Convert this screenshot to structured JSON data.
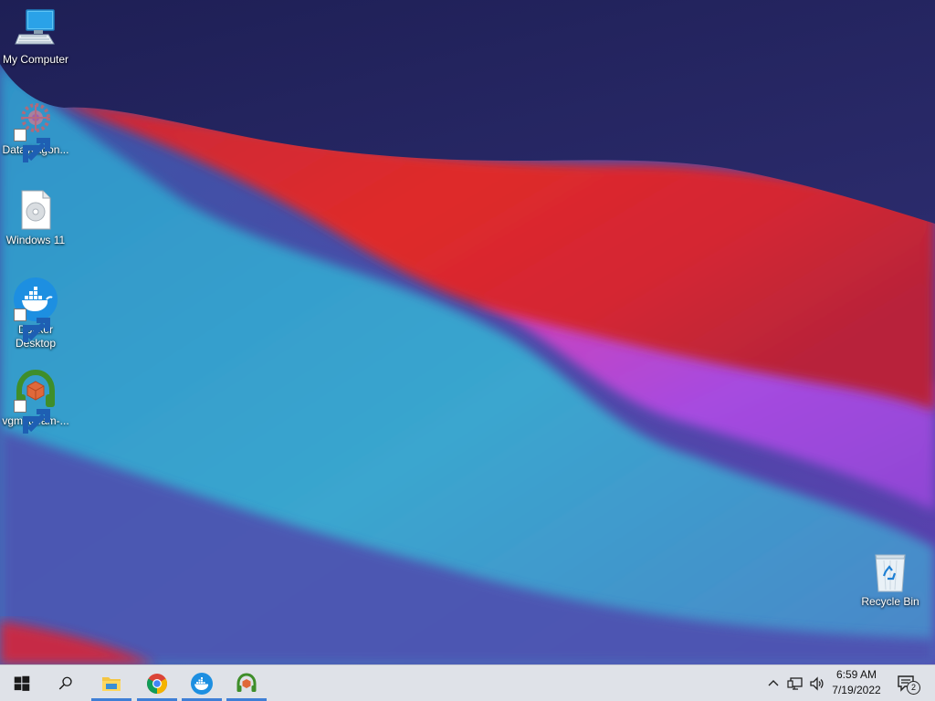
{
  "desktop": {
    "icons": [
      {
        "label": "My Computer",
        "icon": "computer-icon",
        "shortcut": false
      },
      {
        "label": "DataWagon...",
        "icon": "datawagon-icon",
        "shortcut": true
      },
      {
        "label": "Windows 11",
        "icon": "disc-image-file-icon",
        "shortcut": false
      },
      {
        "label": "Docker\nDesktop",
        "icon": "docker-icon",
        "shortcut": true
      },
      {
        "label": "vgmstream-...",
        "icon": "vgmstream-icon",
        "shortcut": true
      }
    ],
    "recycle_bin": {
      "label": "Recycle Bin",
      "icon": "recycle-bin-icon"
    }
  },
  "taskbar": {
    "pinned": [
      {
        "name": "start",
        "icon": "windows-start-icon",
        "active": false
      },
      {
        "name": "search",
        "icon": "search-icon",
        "active": false
      },
      {
        "name": "file-explorer",
        "icon": "file-explorer-icon",
        "active": true
      },
      {
        "name": "chrome",
        "icon": "chrome-icon",
        "active": true
      },
      {
        "name": "docker",
        "icon": "docker-icon",
        "active": true
      },
      {
        "name": "vgmstream",
        "icon": "vgmstream-icon",
        "active": true
      }
    ],
    "tray": {
      "icons": [
        "chevron-up-icon",
        "network-icon",
        "volume-icon"
      ],
      "time": "6:59 AM",
      "date": "7/19/2022",
      "notification_count": "2"
    }
  },
  "colors": {
    "taskbar_bg": "#dfe2e8",
    "active_indicator": "#3f7fd6",
    "wallpaper_navy": "#25265e",
    "wallpaper_red": "#d8262e",
    "wallpaper_cyan": "#3e9ccc",
    "wallpaper_purple": "#a84ad8"
  }
}
